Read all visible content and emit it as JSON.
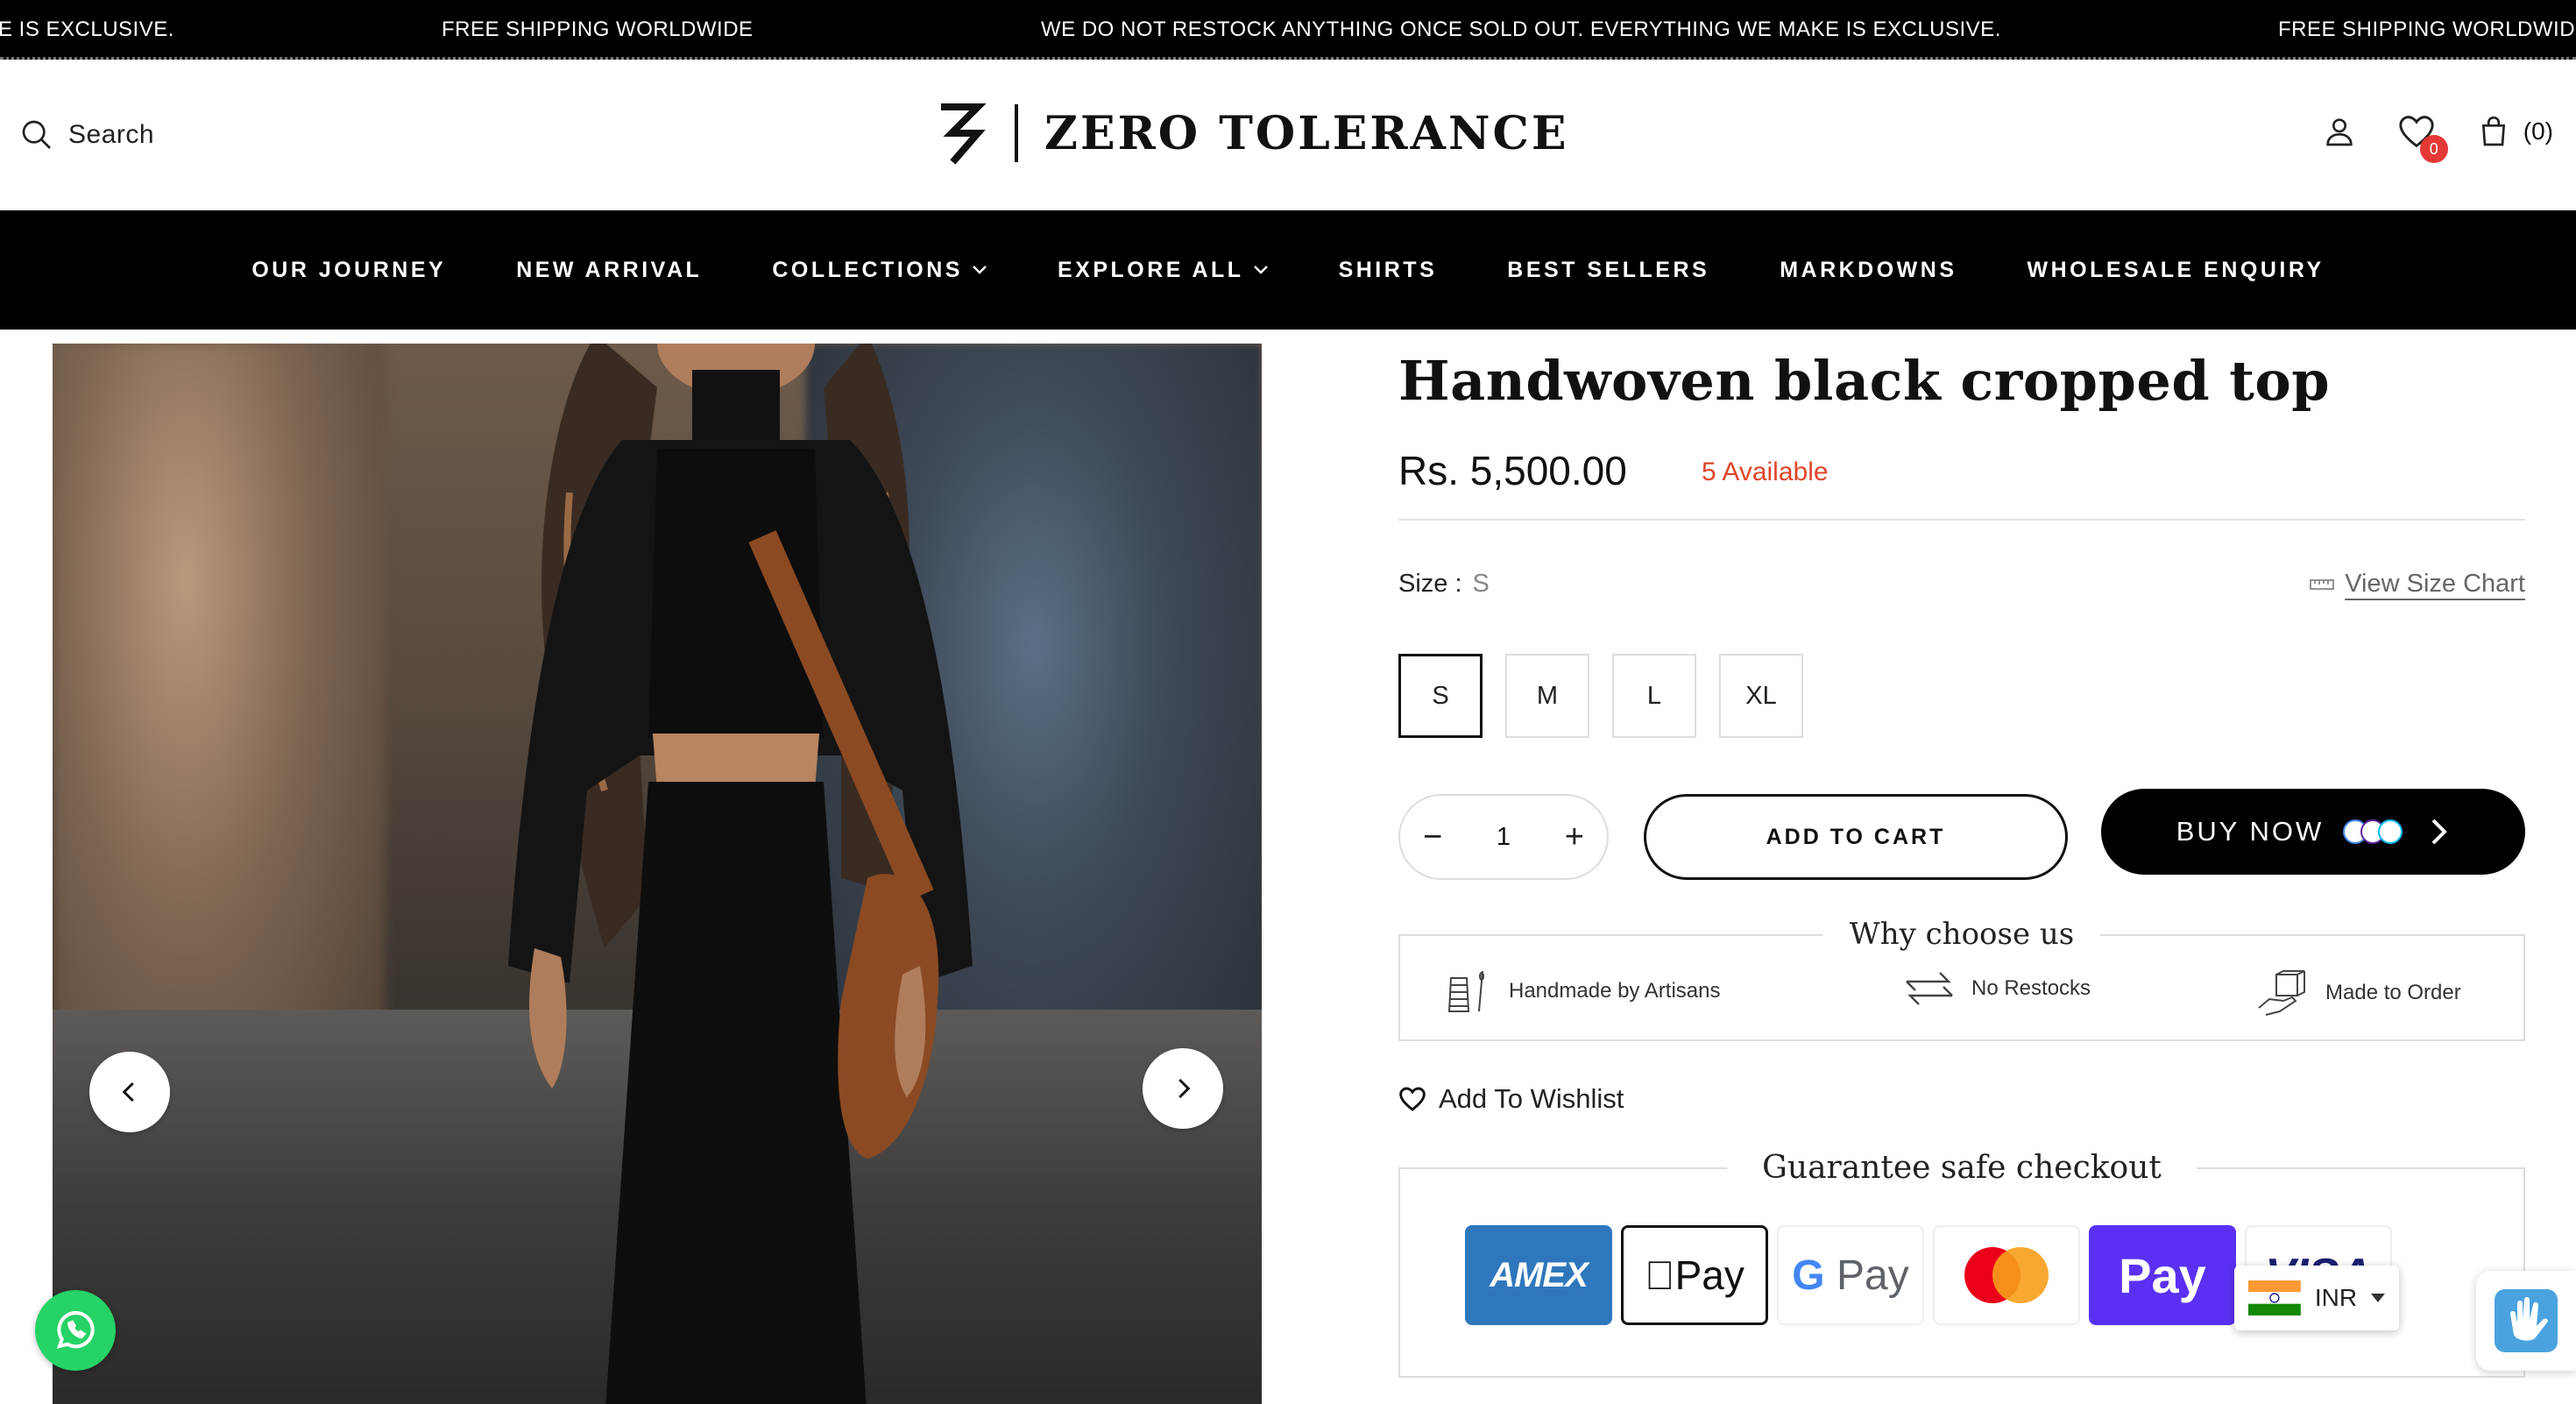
{
  "announcement": {
    "items": [
      "E IS EXCLUSIVE.",
      "FREE SHIPPING WORLDWIDE",
      "WE DO NOT RESTOCK ANYTHING ONCE SOLD OUT. EVERYTHING WE MAKE IS EXCLUSIVE.",
      "FREE SHIPPING WORLDWIDE"
    ]
  },
  "header": {
    "search_label": "Search",
    "logo_text": "ZERO TOLERANCE",
    "wishlist_count": "0",
    "cart_count": "(0)"
  },
  "nav": {
    "items": [
      {
        "label": "OUR JOURNEY"
      },
      {
        "label": "NEW ARRIVAL"
      },
      {
        "label": "COLLECTIONS",
        "dropdown": true
      },
      {
        "label": "EXPLORE ALL",
        "dropdown": true
      },
      {
        "label": "SHIRTS"
      },
      {
        "label": "BEST SELLERS"
      },
      {
        "label": "MARKDOWNS"
      },
      {
        "label": "WHOLESALE ENQUIRY"
      }
    ]
  },
  "product": {
    "title": "Handwoven black cropped top",
    "price": "Rs. 5,500.00",
    "availability": "5 Available",
    "size_label": "Size :",
    "selected_size": "S",
    "size_chart_label": "View Size Chart",
    "sizes": [
      "S",
      "M",
      "L",
      "XL"
    ],
    "quantity": "1",
    "add_to_cart_label": "ADD TO CART",
    "buy_now_label": "BUY NOW",
    "wishlist_label": "Add To Wishlist"
  },
  "why_choose": {
    "title": "Why choose us",
    "items": [
      {
        "label": "Handmade by Artisans",
        "icon": "thread-needle-icon"
      },
      {
        "label": "No Restocks",
        "icon": "exchange-arrows-icon"
      },
      {
        "label": "Made to Order",
        "icon": "box-hand-icon"
      }
    ]
  },
  "checkout": {
    "title": "Guarantee safe checkout",
    "cards": [
      "AMEX",
      "Pay",
      "G Pay",
      "mastercard",
      "Pay",
      "VISA"
    ]
  },
  "currency": {
    "code": "INR"
  },
  "colors": {
    "accent_red": "#e0452a",
    "black": "#000000",
    "whatsapp_green": "#25d366"
  }
}
